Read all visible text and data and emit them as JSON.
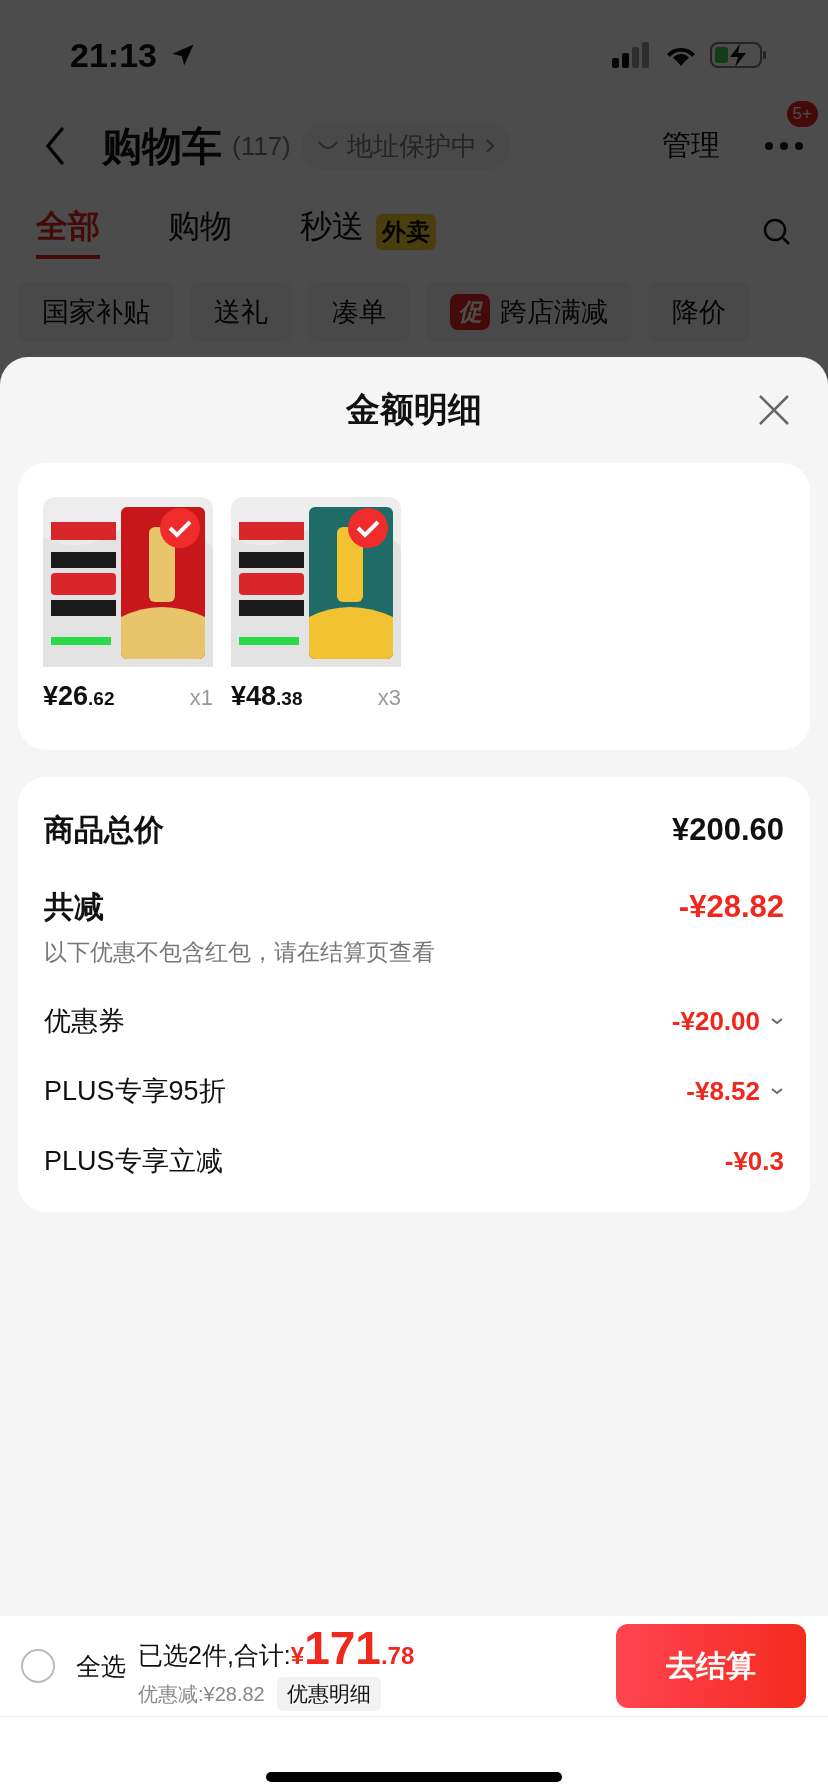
{
  "status_bar": {
    "time": "21:13"
  },
  "header": {
    "title": "购物车",
    "count": "(117)",
    "address_pill": "地址保护中",
    "manage": "管理",
    "badge": "5+"
  },
  "tabs": [
    {
      "label": "全部",
      "selected": true
    },
    {
      "label": "购物",
      "selected": false
    },
    {
      "label": "秒送",
      "selected": false,
      "tag": "外卖"
    }
  ],
  "chips": [
    {
      "label": "国家补贴"
    },
    {
      "label": "送礼"
    },
    {
      "label": "凑单"
    },
    {
      "label": "跨店满减",
      "tag": "促"
    },
    {
      "label": "降价"
    }
  ],
  "sheet": {
    "title": "金额明细",
    "items": [
      {
        "kind": "picture",
        "price": "¥26.62",
        "quantity": "x1",
        "checked": true
      },
      {
        "kind": "picture",
        "price": "¥48.38",
        "quantity": "x3",
        "checked": true
      }
    ],
    "summary": [
      {
        "kind": "total",
        "label": "商品总价",
        "value": "¥200.60"
      },
      {
        "kind": "reduction",
        "label": "共减",
        "value": "-¥28.82"
      },
      {
        "kind": "note",
        "label": "以下优惠不包含红包，请在结算页查看"
      },
      {
        "kind": "discount",
        "label": "优惠券",
        "value": "-¥20.00",
        "expandable": true
      },
      {
        "kind": "discount",
        "label": "PLUS专享95折",
        "value": "-¥8.52",
        "expandable": true
      },
      {
        "kind": "discount",
        "label": "PLUS专享立减",
        "value": "-¥0.3",
        "expandable": false
      }
    ]
  },
  "bottom_bar": {
    "select_all": {
      "label": "全选",
      "checked": false
    },
    "selected_text": "已选2件,合计:",
    "total": "¥171.78",
    "saved": "优惠减:¥28.82",
    "detail_button": "优惠明细",
    "checkout_button": "去结算"
  }
}
